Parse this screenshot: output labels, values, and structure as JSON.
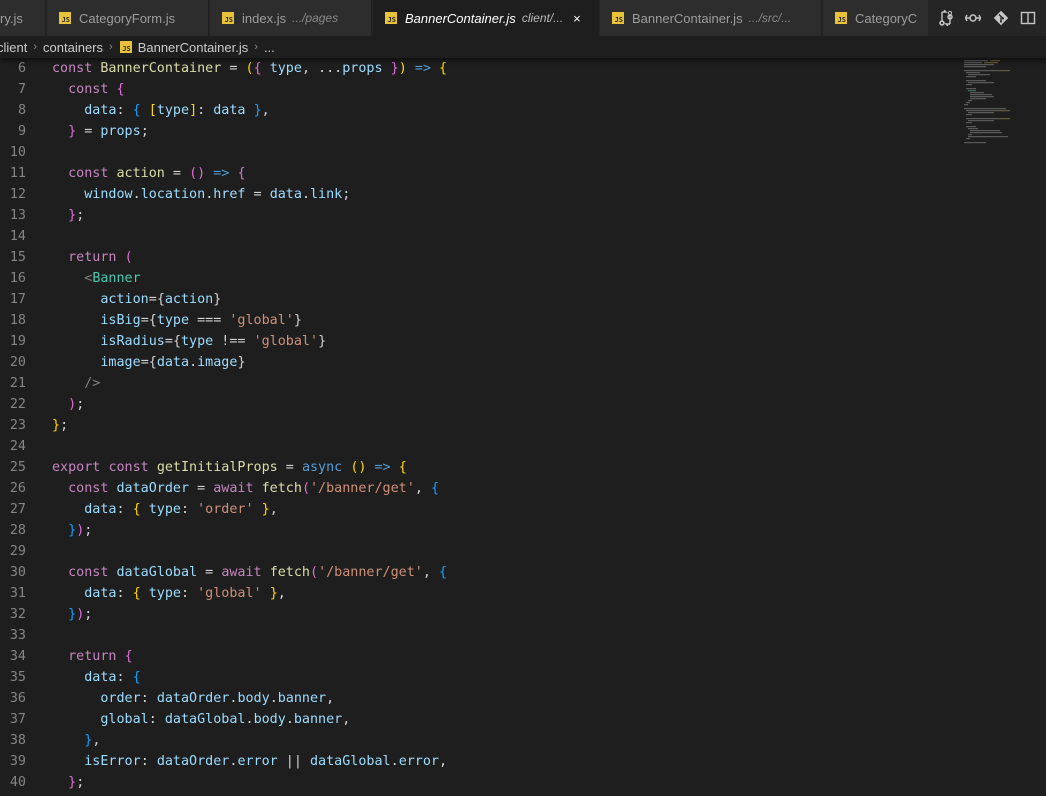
{
  "tabs": [
    {
      "name": "ry.js",
      "desc": "",
      "active": false
    },
    {
      "name": "CategoryForm.js",
      "desc": "",
      "active": false
    },
    {
      "name": "index.js",
      "desc": ".../pages",
      "active": false
    },
    {
      "name": "BannerContainer.js",
      "desc": "client/...",
      "active": true
    },
    {
      "name": "BannerContainer.js",
      "desc": ".../src/...",
      "active": false
    },
    {
      "name": "CategoryC",
      "desc": "",
      "active": false
    }
  ],
  "file_icon_text": "JS",
  "close_glyph": "×",
  "toolbar_icons": [
    "compare-changes-icon",
    "open-changes-icon",
    "git-icon",
    "split-editor-icon"
  ],
  "breadcrumb": {
    "items": [
      "client",
      "containers",
      "BannerContainer.js",
      "..."
    ],
    "separator": "›"
  },
  "code_lines": [
    {
      "n": "6",
      "tokens": [
        [
          "kw",
          "const "
        ],
        [
          "fn",
          "BannerContainer"
        ],
        [
          "plain",
          " = "
        ],
        [
          "br1",
          "("
        ],
        [
          "br2",
          "{"
        ],
        [
          "plain",
          " "
        ],
        [
          "var",
          "type"
        ],
        [
          "plain",
          ", ..."
        ],
        [
          "var",
          "props"
        ],
        [
          "plain",
          " "
        ],
        [
          "br2",
          "}"
        ],
        [
          "br1",
          ")"
        ],
        [
          "plain",
          " "
        ],
        [
          "store",
          "=>"
        ],
        [
          "plain",
          " "
        ],
        [
          "br1",
          "{"
        ]
      ]
    },
    {
      "n": "7",
      "tokens": [
        [
          "plain",
          "  "
        ],
        [
          "kw",
          "const "
        ],
        [
          "br2",
          "{"
        ]
      ]
    },
    {
      "n": "8",
      "tokens": [
        [
          "plain",
          "    "
        ],
        [
          "var",
          "data"
        ],
        [
          "plain",
          ": "
        ],
        [
          "br3",
          "{"
        ],
        [
          "plain",
          " "
        ],
        [
          "br1",
          "["
        ],
        [
          "var",
          "type"
        ],
        [
          "br1",
          "]"
        ],
        [
          "plain",
          ": "
        ],
        [
          "var",
          "data"
        ],
        [
          "plain",
          " "
        ],
        [
          "br3",
          "}"
        ],
        [
          "plain",
          ","
        ]
      ]
    },
    {
      "n": "9",
      "tokens": [
        [
          "plain",
          "  "
        ],
        [
          "br2",
          "}"
        ],
        [
          "plain",
          " = "
        ],
        [
          "var",
          "props"
        ],
        [
          "plain",
          ";"
        ]
      ]
    },
    {
      "n": "10",
      "tokens": []
    },
    {
      "n": "11",
      "tokens": [
        [
          "plain",
          "  "
        ],
        [
          "kw",
          "const "
        ],
        [
          "fn",
          "action"
        ],
        [
          "plain",
          " = "
        ],
        [
          "br2",
          "("
        ],
        [
          "br2",
          ")"
        ],
        [
          "plain",
          " "
        ],
        [
          "store",
          "=>"
        ],
        [
          "plain",
          " "
        ],
        [
          "br2",
          "{"
        ]
      ]
    },
    {
      "n": "12",
      "tokens": [
        [
          "plain",
          "    "
        ],
        [
          "var",
          "window"
        ],
        [
          "plain",
          "."
        ],
        [
          "var",
          "location"
        ],
        [
          "plain",
          "."
        ],
        [
          "var",
          "href"
        ],
        [
          "plain",
          " = "
        ],
        [
          "var",
          "data"
        ],
        [
          "plain",
          "."
        ],
        [
          "var",
          "link"
        ],
        [
          "plain",
          ";"
        ]
      ]
    },
    {
      "n": "13",
      "tokens": [
        [
          "plain",
          "  "
        ],
        [
          "br2",
          "}"
        ],
        [
          "plain",
          ";"
        ]
      ]
    },
    {
      "n": "14",
      "tokens": []
    },
    {
      "n": "15",
      "tokens": [
        [
          "plain",
          "  "
        ],
        [
          "kw",
          "return "
        ],
        [
          "br2",
          "("
        ]
      ]
    },
    {
      "n": "16",
      "tokens": [
        [
          "plain",
          "    "
        ],
        [
          "ang",
          "<"
        ],
        [
          "tag",
          "Banner"
        ]
      ]
    },
    {
      "n": "17",
      "tokens": [
        [
          "plain",
          "      "
        ],
        [
          "var",
          "action"
        ],
        [
          "plain",
          "="
        ],
        [
          "plain",
          "{"
        ],
        [
          "var",
          "action"
        ],
        [
          "plain",
          "}"
        ]
      ]
    },
    {
      "n": "18",
      "tokens": [
        [
          "plain",
          "      "
        ],
        [
          "var",
          "isBig"
        ],
        [
          "plain",
          "="
        ],
        [
          "plain",
          "{"
        ],
        [
          "var",
          "type"
        ],
        [
          "plain",
          " === "
        ],
        [
          "str",
          "'global'"
        ],
        [
          "plain",
          "}"
        ]
      ]
    },
    {
      "n": "19",
      "tokens": [
        [
          "plain",
          "      "
        ],
        [
          "var",
          "isRadius"
        ],
        [
          "plain",
          "="
        ],
        [
          "plain",
          "{"
        ],
        [
          "var",
          "type"
        ],
        [
          "plain",
          " !== "
        ],
        [
          "str",
          "'global'"
        ],
        [
          "plain",
          "}"
        ]
      ]
    },
    {
      "n": "20",
      "tokens": [
        [
          "plain",
          "      "
        ],
        [
          "var",
          "image"
        ],
        [
          "plain",
          "="
        ],
        [
          "plain",
          "{"
        ],
        [
          "var",
          "data"
        ],
        [
          "plain",
          "."
        ],
        [
          "var",
          "image"
        ],
        [
          "plain",
          "}"
        ]
      ]
    },
    {
      "n": "21",
      "tokens": [
        [
          "plain",
          "    "
        ],
        [
          "ang",
          "/>"
        ]
      ]
    },
    {
      "n": "22",
      "tokens": [
        [
          "plain",
          "  "
        ],
        [
          "br2",
          ")"
        ],
        [
          "plain",
          ";"
        ]
      ]
    },
    {
      "n": "23",
      "tokens": [
        [
          "br1",
          "}"
        ],
        [
          "plain",
          ";"
        ]
      ]
    },
    {
      "n": "24",
      "tokens": []
    },
    {
      "n": "25",
      "tokens": [
        [
          "kw",
          "export "
        ],
        [
          "kw",
          "const "
        ],
        [
          "fn",
          "getInitialProps"
        ],
        [
          "plain",
          " = "
        ],
        [
          "store",
          "async"
        ],
        [
          "plain",
          " "
        ],
        [
          "br1",
          "("
        ],
        [
          "br1",
          ")"
        ],
        [
          "plain",
          " "
        ],
        [
          "store",
          "=>"
        ],
        [
          "plain",
          " "
        ],
        [
          "br1",
          "{"
        ]
      ]
    },
    {
      "n": "26",
      "tokens": [
        [
          "plain",
          "  "
        ],
        [
          "kw",
          "const "
        ],
        [
          "var",
          "dataOrder"
        ],
        [
          "plain",
          " = "
        ],
        [
          "kw",
          "await "
        ],
        [
          "fn",
          "fetch"
        ],
        [
          "br2",
          "("
        ],
        [
          "str",
          "'/banner/get'"
        ],
        [
          "plain",
          ", "
        ],
        [
          "br3",
          "{"
        ]
      ]
    },
    {
      "n": "27",
      "tokens": [
        [
          "plain",
          "    "
        ],
        [
          "var",
          "data"
        ],
        [
          "plain",
          ": "
        ],
        [
          "br1",
          "{"
        ],
        [
          "plain",
          " "
        ],
        [
          "var",
          "type"
        ],
        [
          "plain",
          ": "
        ],
        [
          "str",
          "'order'"
        ],
        [
          "plain",
          " "
        ],
        [
          "br1",
          "}"
        ],
        [
          "plain",
          ","
        ]
      ]
    },
    {
      "n": "28",
      "tokens": [
        [
          "plain",
          "  "
        ],
        [
          "br3",
          "}"
        ],
        [
          "br2",
          ")"
        ],
        [
          "plain",
          ";"
        ]
      ]
    },
    {
      "n": "29",
      "tokens": []
    },
    {
      "n": "30",
      "tokens": [
        [
          "plain",
          "  "
        ],
        [
          "kw",
          "const "
        ],
        [
          "var",
          "dataGlobal"
        ],
        [
          "plain",
          " = "
        ],
        [
          "kw",
          "await "
        ],
        [
          "fn",
          "fetch"
        ],
        [
          "br2",
          "("
        ],
        [
          "str",
          "'/banner/get'"
        ],
        [
          "plain",
          ", "
        ],
        [
          "br3",
          "{"
        ]
      ]
    },
    {
      "n": "31",
      "tokens": [
        [
          "plain",
          "    "
        ],
        [
          "var",
          "data"
        ],
        [
          "plain",
          ": "
        ],
        [
          "br1",
          "{"
        ],
        [
          "plain",
          " "
        ],
        [
          "var",
          "type"
        ],
        [
          "plain",
          ": "
        ],
        [
          "str",
          "'global'"
        ],
        [
          "plain",
          " "
        ],
        [
          "br1",
          "}"
        ],
        [
          "plain",
          ","
        ]
      ]
    },
    {
      "n": "32",
      "tokens": [
        [
          "plain",
          "  "
        ],
        [
          "br3",
          "}"
        ],
        [
          "br2",
          ")"
        ],
        [
          "plain",
          ";"
        ]
      ]
    },
    {
      "n": "33",
      "tokens": []
    },
    {
      "n": "34",
      "tokens": [
        [
          "plain",
          "  "
        ],
        [
          "kw",
          "return "
        ],
        [
          "br2",
          "{"
        ]
      ]
    },
    {
      "n": "35",
      "tokens": [
        [
          "plain",
          "    "
        ],
        [
          "var",
          "data"
        ],
        [
          "plain",
          ": "
        ],
        [
          "br3",
          "{"
        ]
      ]
    },
    {
      "n": "36",
      "tokens": [
        [
          "plain",
          "      "
        ],
        [
          "var",
          "order"
        ],
        [
          "plain",
          ": "
        ],
        [
          "var",
          "dataOrder"
        ],
        [
          "plain",
          "."
        ],
        [
          "var",
          "body"
        ],
        [
          "plain",
          "."
        ],
        [
          "var",
          "banner"
        ],
        [
          "plain",
          ","
        ]
      ]
    },
    {
      "n": "37",
      "tokens": [
        [
          "plain",
          "      "
        ],
        [
          "var",
          "global"
        ],
        [
          "plain",
          ": "
        ],
        [
          "var",
          "dataGlobal"
        ],
        [
          "plain",
          "."
        ],
        [
          "var",
          "body"
        ],
        [
          "plain",
          "."
        ],
        [
          "var",
          "banner"
        ],
        [
          "plain",
          ","
        ]
      ]
    },
    {
      "n": "38",
      "tokens": [
        [
          "plain",
          "    "
        ],
        [
          "br3",
          "}"
        ],
        [
          "plain",
          ","
        ]
      ]
    },
    {
      "n": "39",
      "tokens": [
        [
          "plain",
          "    "
        ],
        [
          "var",
          "isError"
        ],
        [
          "plain",
          ": "
        ],
        [
          "var",
          "dataOrder"
        ],
        [
          "plain",
          "."
        ],
        [
          "var",
          "error"
        ],
        [
          "plain",
          " || "
        ],
        [
          "var",
          "dataGlobal"
        ],
        [
          "plain",
          "."
        ],
        [
          "var",
          "error"
        ],
        [
          "plain",
          ","
        ]
      ]
    },
    {
      "n": "40",
      "tokens": [
        [
          "plain",
          "  "
        ],
        [
          "br2",
          "}"
        ],
        [
          "plain",
          ";"
        ]
      ]
    }
  ],
  "colors": {
    "editor_bg": "#1e1e1e",
    "tabbar_bg": "#252526",
    "keyword": "#c586c0",
    "variable": "#9cdcfe",
    "function": "#dcdcaa",
    "string": "#ce9178",
    "tag": "#4ec9b0",
    "js_icon": "#e8c33a"
  }
}
